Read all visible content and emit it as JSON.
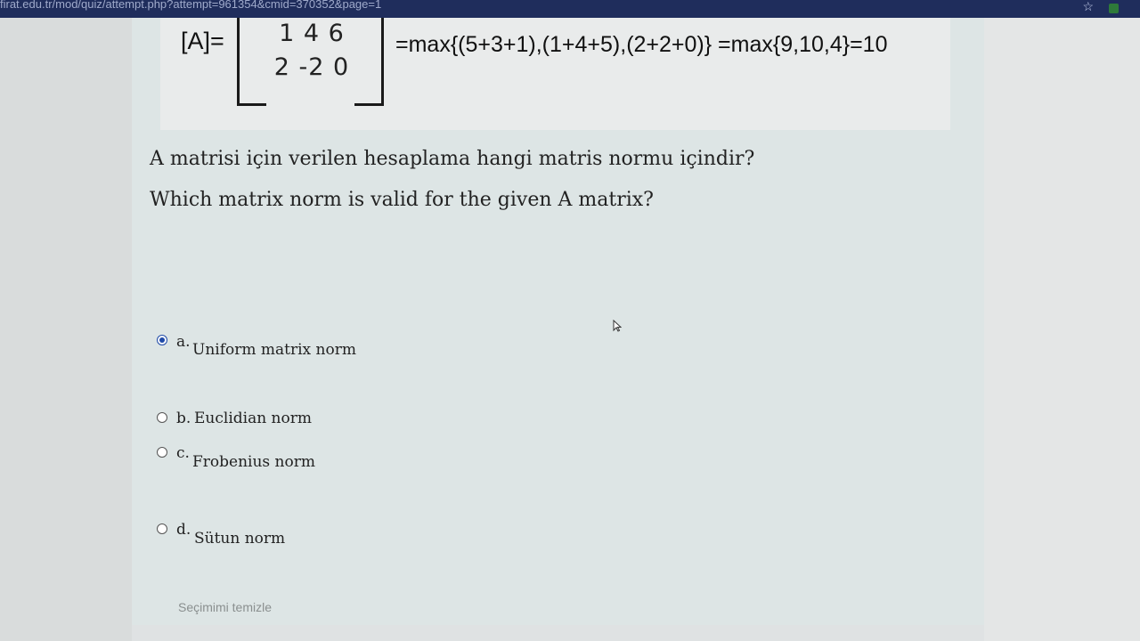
{
  "browser": {
    "url": "firat.edu.tr/mod/quiz/attempt.php?attempt=961354&cmid=370352&page=1"
  },
  "formula": {
    "label": "[A]=",
    "matrix_rows": [
      "1 4 6",
      "2 -2 0"
    ],
    "expression": "=max{(5+3+1),(1+4+5),(2+2+0)} =max{9,10,4}=10"
  },
  "question": {
    "text_tr": "A matrisi için verilen hesaplama hangi matris normu içindir?",
    "text_en": "Which matrix norm is valid for the given A matrix?"
  },
  "answers": [
    {
      "letter": "a.",
      "text": "Uniform matrix norm",
      "selected": true
    },
    {
      "letter": "b.",
      "text": "Euclidian norm",
      "selected": false
    },
    {
      "letter": "c.",
      "text": "Frobenius norm",
      "selected": false
    },
    {
      "letter": "d.",
      "text": "Sütun norm",
      "selected": false
    }
  ],
  "clear_choice_label": "Seçimimi temizle",
  "colors": {
    "browser_bar": "#1f2d5c",
    "panel_background": "#dde5e5",
    "radio_selected": "#1f4aa8"
  },
  "icons": {
    "star": "star-icon",
    "extension": "extension-icon",
    "cursor": "cursor-icon"
  }
}
